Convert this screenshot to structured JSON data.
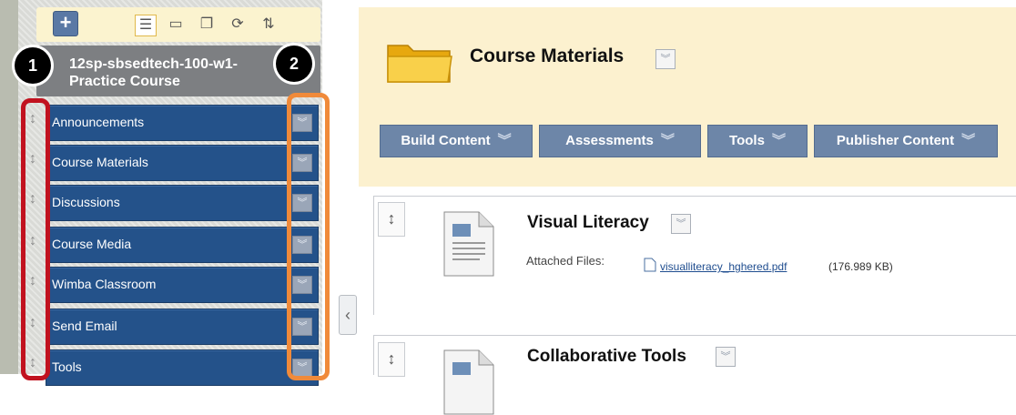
{
  "sidebar": {
    "course_title": "12sp-sbsedtech-100-w1-Practice Course",
    "menu_items": [
      {
        "label": "Announcements"
      },
      {
        "label": "Course Materials"
      },
      {
        "label": "Discussions"
      },
      {
        "label": "Course Media"
      },
      {
        "label": "Wimba Classroom"
      },
      {
        "label": "Send Email"
      },
      {
        "label": "Tools"
      }
    ],
    "toolbar_icons": [
      "add-icon",
      "list-view-icon",
      "folder-icon",
      "window-icon",
      "refresh-icon",
      "sort-icon"
    ]
  },
  "annotations": {
    "badge_1": "1",
    "badge_2": "2"
  },
  "main": {
    "page_title": "Course Materials",
    "action_bar": [
      {
        "label": "Build Content"
      },
      {
        "label": "Assessments"
      },
      {
        "label": "Tools"
      },
      {
        "label": "Publisher Content"
      }
    ],
    "items": [
      {
        "title": "Visual Literacy",
        "attached_label": "Attached Files:",
        "file_name": "visualliteracy_hghered.pdf",
        "file_size": "(176.989 KB)"
      },
      {
        "title": "Collaborative Tools"
      }
    ]
  },
  "colors": {
    "menu_blue": "#24528a",
    "header_bg": "#fcf1cf",
    "action_button": "#6d86a8",
    "highlight_red": "#c1121f",
    "highlight_orange": "#f08a3a"
  }
}
